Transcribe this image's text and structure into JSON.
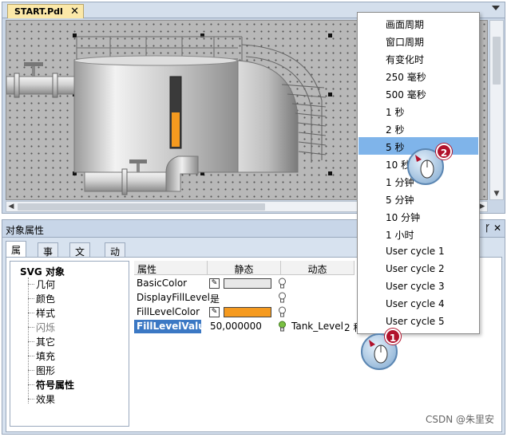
{
  "editor": {
    "tab_title": "START.Pdl",
    "tab_close": "✕"
  },
  "properties_panel": {
    "title": "对象属性",
    "pin_icon": "ᚴ",
    "close_icon": "✕",
    "tabs": [
      {
        "label": "属性",
        "active": true
      },
      {
        "label": "事件",
        "active": false
      },
      {
        "label": "文本",
        "active": false
      },
      {
        "label": "动画",
        "active": false
      }
    ],
    "tree": {
      "root": "SVG 对象",
      "items": [
        {
          "label": "几何",
          "style": "normal"
        },
        {
          "label": "颜色",
          "style": "normal"
        },
        {
          "label": "样式",
          "style": "normal"
        },
        {
          "label": "闪烁",
          "style": "muted"
        },
        {
          "label": "其它",
          "style": "normal"
        },
        {
          "label": "填充",
          "style": "normal"
        },
        {
          "label": "图形",
          "style": "normal"
        },
        {
          "label": "符号属性",
          "style": "strong"
        },
        {
          "label": "效果",
          "style": "normal"
        }
      ]
    },
    "grid": {
      "headers": {
        "attribute": "属性",
        "static": "静态",
        "dynamic": "动态"
      },
      "rows": [
        {
          "name": "BasicColor",
          "static_color": "#e8e8e8",
          "has_picker": true
        },
        {
          "name": "DisplayFillLevel",
          "static_text": "是"
        },
        {
          "name": "FillLevelColor",
          "static_color": "#f59a1f",
          "has_picker": true
        },
        {
          "name": "FillLevelValue",
          "static_text": "50,000000",
          "dynamic_tag": "Tank_Level",
          "dynamic_cycle": "2 秒",
          "selected": true
        }
      ]
    }
  },
  "dropdown": {
    "items": [
      {
        "label": "画面周期"
      },
      {
        "label": "窗口周期"
      },
      {
        "label": "有变化时"
      },
      {
        "label": "250 毫秒"
      },
      {
        "label": "500 毫秒"
      },
      {
        "label": "1 秒"
      },
      {
        "label": "2 秒"
      },
      {
        "label": "5 秒",
        "highlight": true
      },
      {
        "label": "10 秒"
      },
      {
        "label": "1 分钟"
      },
      {
        "label": "5 分钟"
      },
      {
        "label": "10 分钟"
      },
      {
        "label": "1 小时"
      },
      {
        "label": "User cycle 1"
      },
      {
        "label": "User cycle 2"
      },
      {
        "label": "User cycle 3"
      },
      {
        "label": "User cycle 4"
      },
      {
        "label": "User cycle 5"
      }
    ]
  },
  "callouts": {
    "step1": "1",
    "step2": "2"
  },
  "tank": {
    "fill_level_percent": 50
  },
  "colors": {
    "accent_selected": "#3b78c4",
    "menu_highlight": "#7fb4ea",
    "badge": "#b1122c",
    "fill_level": "#f59a1f"
  },
  "watermark": "CSDN @朱里安"
}
